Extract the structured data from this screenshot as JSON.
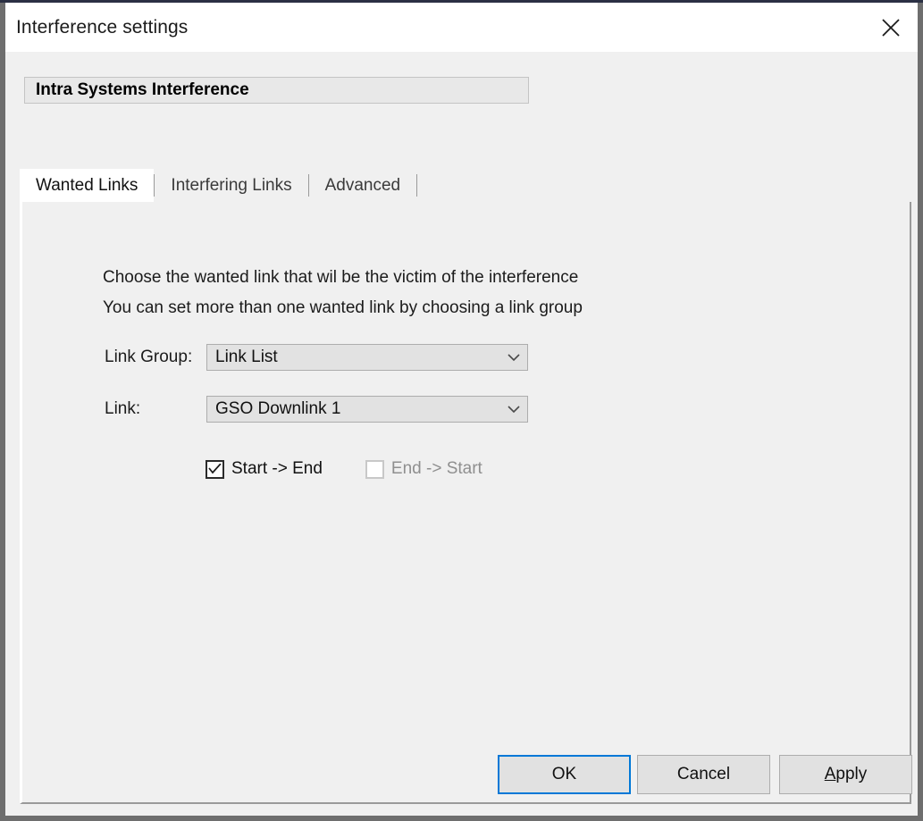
{
  "window": {
    "title": "Interference settings",
    "close_icon": "close-icon"
  },
  "group": {
    "header": "Intra Systems Interference"
  },
  "tabs": [
    {
      "label": "Wanted Links",
      "active": true
    },
    {
      "label": "Interfering Links",
      "active": false
    },
    {
      "label": "Advanced",
      "active": false
    }
  ],
  "panel": {
    "intro_line_1": "Choose the wanted link that wil be the victim of the interference",
    "intro_line_2": "You can set more than one wanted link by choosing a link group",
    "link_group": {
      "label": "Link Group:",
      "value": "Link List",
      "arrow_icon": "chevron-down-icon"
    },
    "link": {
      "label": "Link:",
      "value": "GSO Downlink 1",
      "arrow_icon": "chevron-down-icon"
    },
    "direction": {
      "start_end": {
        "label": "Start -> End",
        "checked": true,
        "enabled": true
      },
      "end_start": {
        "label": "End -> Start",
        "checked": false,
        "enabled": false
      }
    }
  },
  "footer": {
    "ok": "OK",
    "cancel": "Cancel",
    "apply_accel": "A",
    "apply_rest": "pply"
  },
  "colors": {
    "accent": "#0078d7",
    "dialog_bg": "#f0f0f0",
    "titlebar_bg": "#ffffff",
    "frame": "#6e6e6e"
  }
}
